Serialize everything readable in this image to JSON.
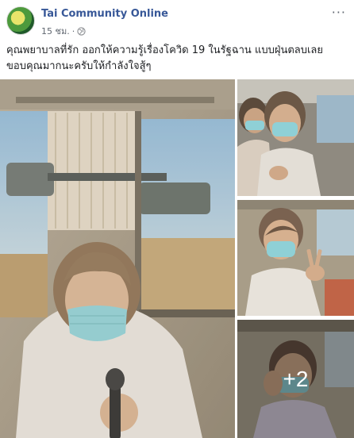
{
  "post": {
    "page_name": "Tai Community Online",
    "time": "15 ชม.",
    "separator": "·",
    "privacy_icon": "globe-icon",
    "more_icon": "ellipsis-icon",
    "text_lines": [
      "คุณพยาบาลที่รัก ออกให้ความรู้เรื่องโควิด 19 ในรัฐฉาน แบบฝุ่นตลบเลย",
      "ขอบคุณมากนะครับให้กำลังใจสู้ๆ"
    ]
  },
  "photos": {
    "more_count": "+2"
  },
  "colors": {
    "link": "#385898",
    "meta": "#606770",
    "text": "#1c1e21"
  }
}
